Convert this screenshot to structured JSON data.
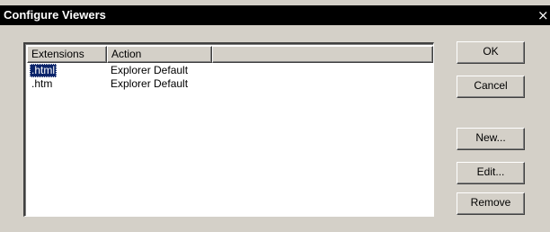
{
  "window": {
    "title": "Configure Viewers",
    "close_glyph": "×"
  },
  "list": {
    "columns": [
      "Extensions",
      "Action"
    ],
    "rows": [
      {
        "extension": ".html",
        "action": "Explorer Default",
        "selected": true
      },
      {
        "extension": ".htm",
        "action": "Explorer Default",
        "selected": false
      }
    ]
  },
  "buttons": {
    "ok": "OK",
    "cancel": "Cancel",
    "new": "New...",
    "edit": "Edit...",
    "remove": "Remove"
  },
  "colors": {
    "face": "#d4d0c8",
    "titlebar": "#000000",
    "selection": "#0a246a"
  }
}
